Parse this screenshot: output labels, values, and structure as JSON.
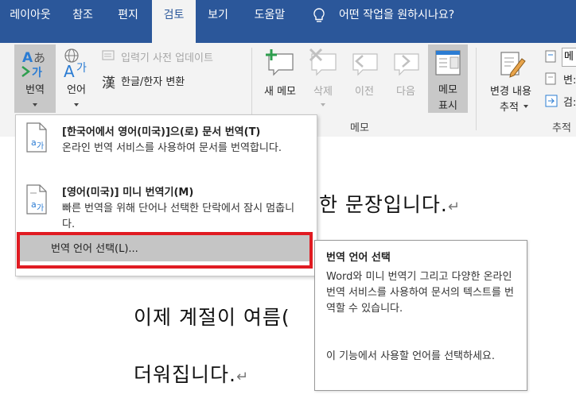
{
  "tabs": [
    "레이아웃",
    "참조",
    "편지",
    "검토",
    "보기",
    "도움말"
  ],
  "tell_me": "어떤 작업을 원하시나요?",
  "ribbon": {
    "translate_label": "번역",
    "language_label": "언어",
    "ime_dict_update": "입력기 사전 업데이트",
    "hangul_hanja_icon": "漢",
    "hangul_hanja": "한글/한자 변환",
    "new_memo": "새 메모",
    "delete": "삭제",
    "previous": "이전",
    "next": "다음",
    "memo_show_1": "메모",
    "memo_show_2": "표시",
    "track_changes_1": "변경 내용",
    "track_changes_2": "추적",
    "memo_group": "메모",
    "track_group": "추적",
    "right_partial_1": "메",
    "right_partial_2": "변:",
    "right_partial_3": "검:"
  },
  "dropdown": {
    "item1_title": "[한국어에서 영어(미국)]으(로) 문서 번역(T)",
    "item1_desc": "온라인 번역 서비스를 사용하여 문서를 번역합니다.",
    "item2_title": "[영어(미국)] 미니 번역기(M)",
    "item2_desc": "빠른 번역을 위해 단어나 선택한 단락에서 잠시 멈춥니다.",
    "item3_label": "번역 언어 선택(L)..."
  },
  "tooltip": {
    "title": "번역 언어 선택",
    "body": "Word와 미니 번역기 그리고 다양한 온라인 번역 서비스를 사용하여 문서의 텍스트를 번역할 수 있습니다.",
    "body2": "이 기능에서 사용할 언어를 선택하세요."
  },
  "document": {
    "line1": "트하기 위한 문장입니다.",
    "line2": "이제 계절이 여름(",
    "line3": "더워집니다.",
    "para_mark": "↵"
  },
  "colors": {
    "tab_bar": "#2b579a",
    "highlight_frame": "#e01b22"
  }
}
